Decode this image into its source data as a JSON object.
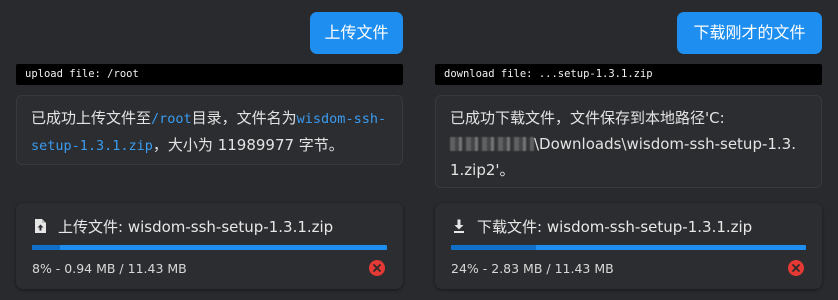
{
  "colors": {
    "background": "#292a2d",
    "accent": "#1e8ef0",
    "progress_done": "#0f6fc9",
    "cancel": "#e53935",
    "path_text": "#3a9bf0"
  },
  "upload": {
    "button_label": "上传文件",
    "command": "upload file: /root",
    "message": {
      "part1": "已成功上传文件至",
      "dir": "/root",
      "part2": "目录，文件名为",
      "filename": "wisdom-ssh-setup-1.3.1.zip",
      "part3": "，大小为 11989977 字节。"
    },
    "transfer": {
      "icon": "upload-file-icon",
      "title": "上传文件: wisdom-ssh-setup-1.3.1.zip",
      "progress_percent": 8,
      "status": "8% - 0.94 MB / 11.43 MB",
      "cancel_icon": "cancel-icon"
    }
  },
  "download": {
    "button_label": "下载刚才的文件",
    "command": "download file: ...setup-1.3.1.zip",
    "message": {
      "part1": "已成功下载文件，文件保存到本地路径'C:",
      "redacted": "redacted-path",
      "part2": "\\Downloads\\wisdom-ssh-setup-1.3.1.zip2'。"
    },
    "transfer": {
      "icon": "download-icon",
      "title": "下载文件: wisdom-ssh-setup-1.3.1.zip",
      "progress_percent": 24,
      "status": "24% - 2.83 MB / 11.43 MB",
      "cancel_icon": "cancel-icon"
    }
  }
}
